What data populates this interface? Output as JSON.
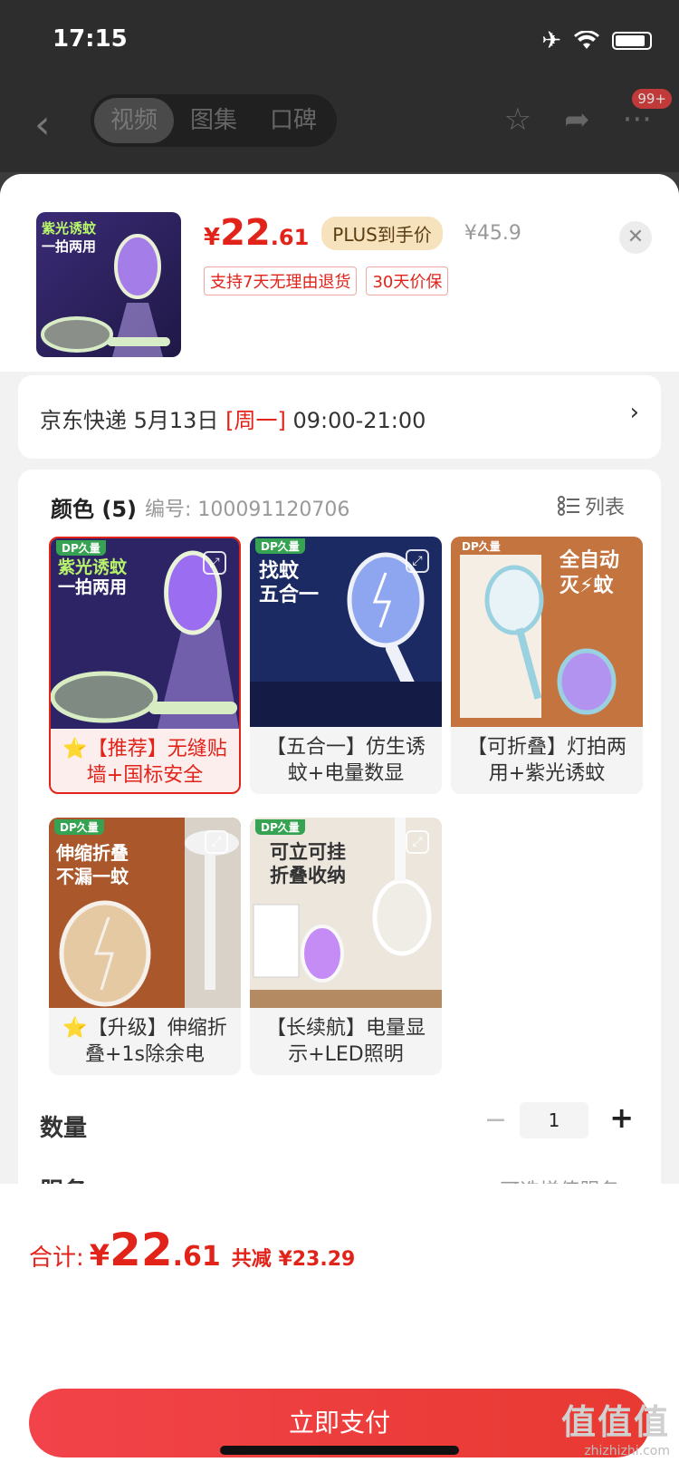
{
  "status_bar": {
    "time": "17:15"
  },
  "top_nav": {
    "tabs": [
      "视频",
      "图集",
      "口碑"
    ],
    "active_tab": "视频",
    "badge": "99+"
  },
  "product": {
    "price_yen": "¥",
    "price_int": "22",
    "price_dec": ".61",
    "plus_tag": "PLUS到手价",
    "original_price": "¥45.9",
    "tags": [
      "支持7天无理由退货",
      "30天价保"
    ],
    "thumb_title_1": "紫光诱蚊",
    "thumb_title_2": "一拍两用"
  },
  "delivery": {
    "carrier_date": "京东快递 5月13日 ",
    "weekday": "[周一]",
    "time_window": " 09:00-21:00"
  },
  "color_section": {
    "title": "颜色 (5)",
    "sku": "编号: 100091120706",
    "list_label": "列表",
    "options": [
      {
        "label": "⭐【推荐】无缝贴墙+国标安全",
        "img_title_1": "紫光诱蚊",
        "img_title_2": "一拍两用",
        "selected": true
      },
      {
        "label": "【五合一】仿生诱蚊+电量数显",
        "img_title_1": "找蚊",
        "img_title_2": "五合一",
        "selected": false
      },
      {
        "label": "【可折叠】灯拍两用+紫光诱蚊",
        "img_title_1": "全自动",
        "img_title_2": "灭⚡蚊",
        "selected": false
      },
      {
        "label": "⭐【升级】伸缩折叠+1s除余电",
        "img_title_1": "伸缩折叠",
        "img_title_2": "不漏一蚊",
        "selected": false
      },
      {
        "label": "【长续航】电量显示+LED照明",
        "img_title_1": "可立可挂",
        "img_title_2": "折叠收纳",
        "selected": false
      }
    ]
  },
  "quantity": {
    "label": "数量",
    "value": "1",
    "minus": "−",
    "plus": "+"
  },
  "service": {
    "label": "服务",
    "value": "可选增值服务 ›"
  },
  "footer": {
    "total_label": "合计:",
    "total_yen": "¥",
    "total_int": "22",
    "total_dec": ".61",
    "savings": "共减 ¥23.29",
    "pay_button": "立即支付"
  },
  "watermark": {
    "big": "值值值",
    "small": "zhizhizhi.com"
  },
  "colors": {
    "accent": "#e2231a",
    "plus_tag_bg": "#f6e3bd"
  }
}
